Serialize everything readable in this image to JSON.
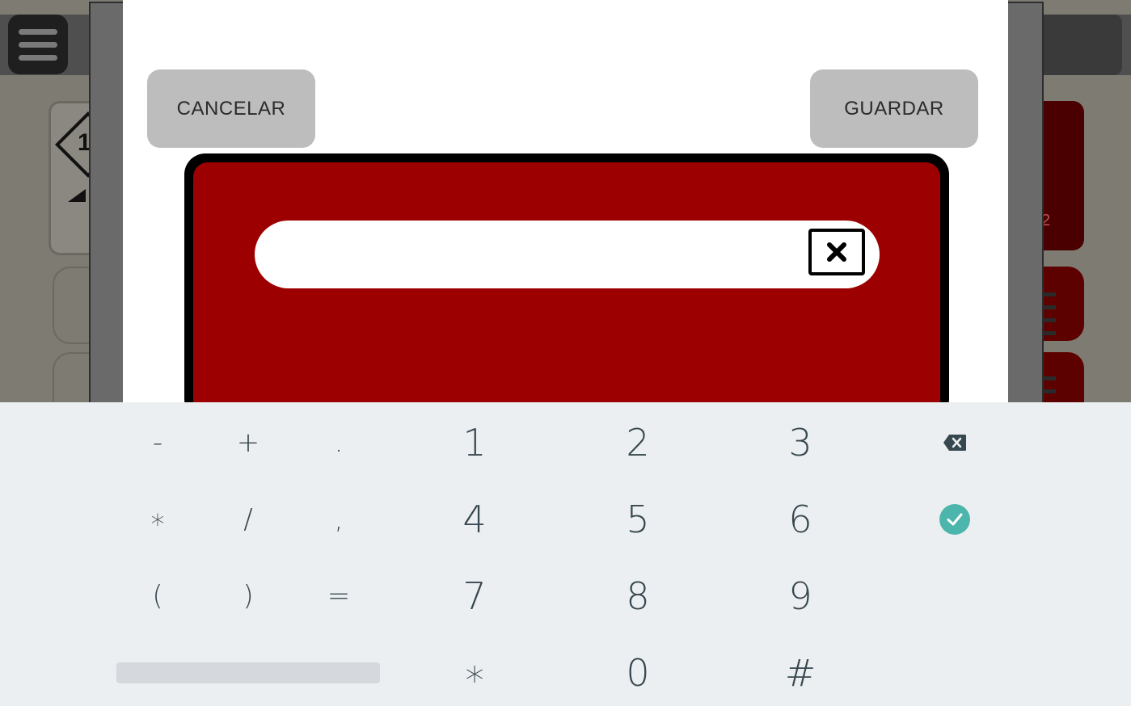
{
  "dialog": {
    "cancel_label": "CANCELAR",
    "save_label": "GUARDAR",
    "input": {
      "value": "",
      "placeholder": ""
    }
  },
  "background": {
    "card_number": "1",
    "right_number": "2"
  },
  "keyboard": {
    "rows": [
      {
        "symbols": [
          "-",
          "+",
          "."
        ],
        "digits": [
          "1",
          "2",
          "3"
        ]
      },
      {
        "symbols": [
          "∗",
          "/",
          ","
        ],
        "digits": [
          "4",
          "5",
          "6"
        ]
      },
      {
        "symbols": [
          "(",
          ")",
          "="
        ],
        "digits": [
          "7",
          "8",
          "9"
        ]
      },
      {
        "symbols": [],
        "digits": [
          "∗",
          "0",
          "#"
        ]
      }
    ],
    "backspace_icon": "backspace-icon",
    "enter_icon": "check-circle-icon"
  },
  "colors": {
    "panel_red": "#9d0000",
    "button_gray": "#bdbdbd",
    "keyboard_bg": "#eceff1",
    "key_text": "#37474f",
    "accent_teal": "#4db6ac"
  }
}
